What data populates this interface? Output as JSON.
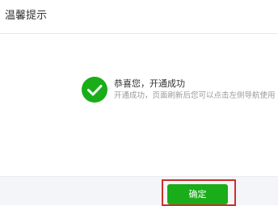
{
  "dialog": {
    "title": "温馨提示"
  },
  "message": {
    "icon": "check-circle-icon",
    "title": "恭喜您，开通成功",
    "description": "开通成功，页面刷新后您可以点击左侧导航使用"
  },
  "footer": {
    "confirm_label": "确定"
  },
  "colors": {
    "success": "#1aad19",
    "highlight": "#c9302c",
    "footer_bg": "#f4f5f9"
  }
}
